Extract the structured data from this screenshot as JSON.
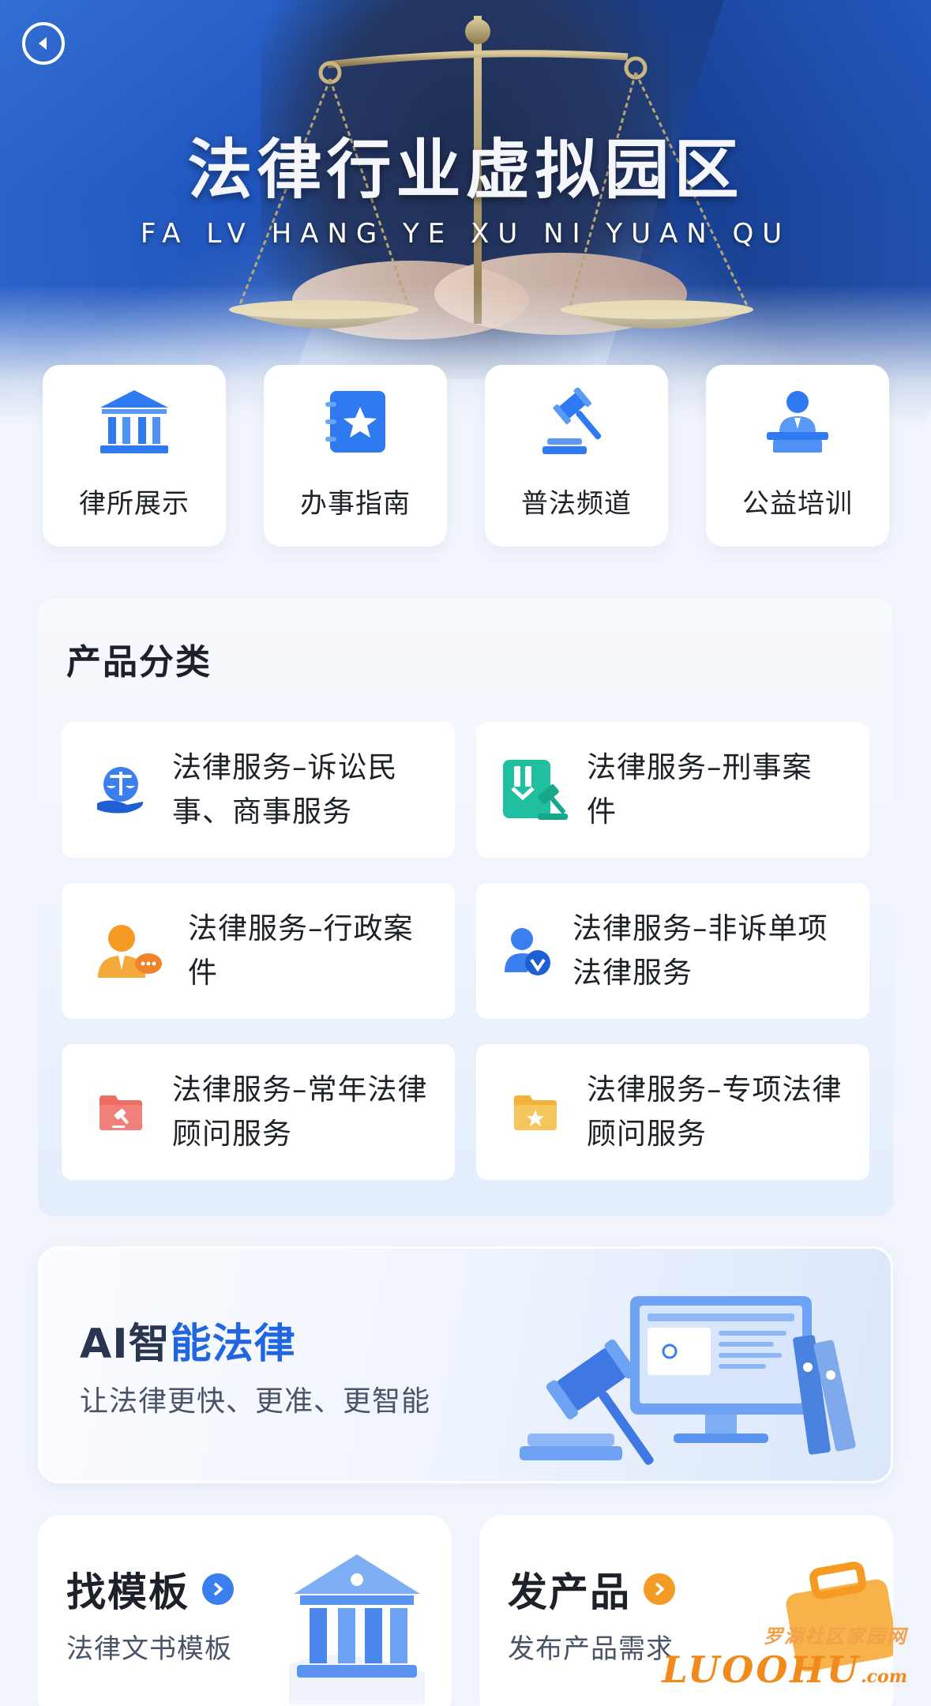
{
  "hero": {
    "title": "法律行业虚拟园区",
    "subtitle": "FA LV HANG YE XU NI YUAN QU"
  },
  "nav": {
    "items": [
      {
        "label": "律所展示",
        "icon": "bank-building-icon"
      },
      {
        "label": "办事指南",
        "icon": "guide-star-icon"
      },
      {
        "label": "普法频道",
        "icon": "gavel-icon"
      },
      {
        "label": "公益培训",
        "icon": "lecturer-podium-icon"
      }
    ]
  },
  "categories": {
    "title": "产品分类",
    "items": [
      {
        "line1": "法律服务–诉讼民",
        "line2": "事、商事服务",
        "icon": "justice-scale-hand-icon"
      },
      {
        "line1": "法律服务–刑事案",
        "line2": "件",
        "icon": "criminal-gavel-document-icon"
      },
      {
        "line1": "法律服务–行政案",
        "line2": "件",
        "icon": "consultant-person-icon"
      },
      {
        "line1": "法律服务–非诉单项",
        "line2": "法律服务",
        "icon": "verified-person-icon"
      },
      {
        "line1": "法律服务–常年法律",
        "line2": "顾问服务",
        "icon": "red-folder-gavel-icon"
      },
      {
        "line1": "法律服务–专项法律",
        "line2": "顾问服务",
        "icon": "gold-folder-star-icon"
      }
    ]
  },
  "ai_banner": {
    "title_part1": "AI智",
    "title_part2": "能法律",
    "subtitle": "让法律更快、更准、更智能"
  },
  "bottom_cards": [
    {
      "title": "找模板",
      "subtitle": "法律文书模板",
      "accent": "#3a7ef0"
    },
    {
      "title": "发产品",
      "subtitle": "发布产品需求",
      "accent": "#f59a23"
    }
  ],
  "watermark": {
    "line1": "罗湖社区家园网",
    "line2": "LUOOHU",
    "line3": ".com"
  },
  "colors": {
    "primary": "#1f66e0",
    "background": "#f1f5fb",
    "hero_blue": "#1a3e8a"
  }
}
